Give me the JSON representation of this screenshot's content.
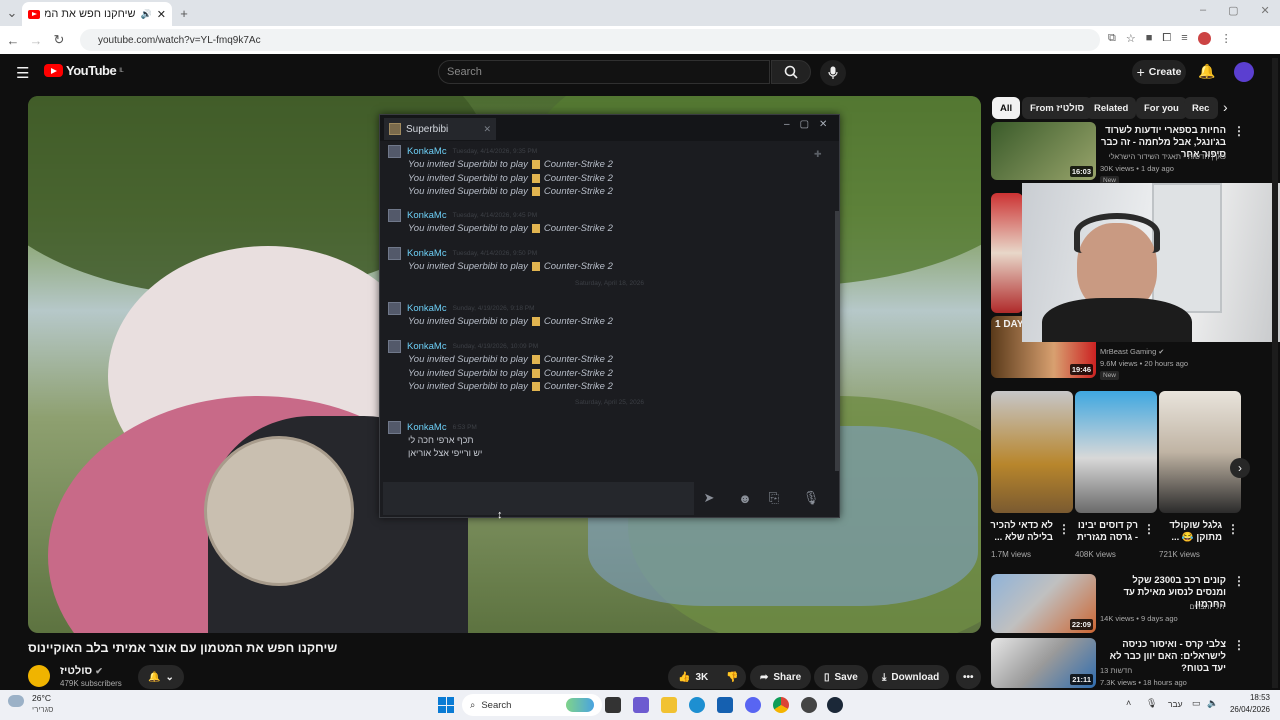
{
  "browser": {
    "tab_title": "שיחקנו חפש את המטמון עם אוצר אמיתי בלב האוקיינוס - YouTube",
    "url": "youtube.com/watch?v=YL-fmq9k7Ac"
  },
  "youtube": {
    "logo_text": "YouTube",
    "logo_region": "IL",
    "search_placeholder": "Search",
    "create_label": "Create"
  },
  "steam": {
    "friend_name": "Superbibi",
    "messages": [
      {
        "name": "KonkaMc",
        "time": "Tuesday, 4/14/2026, 9:35 PM",
        "lines": [
          "You invited Superbibi to play",
          "You invited Superbibi to play",
          "You invited Superbibi to play"
        ]
      },
      {
        "name": "KonkaMc",
        "time": "Tuesday, 4/14/2026, 9:45 PM",
        "lines": [
          "You invited Superbibi to play"
        ]
      },
      {
        "name": "KonkaMc",
        "time": "Tuesday, 4/14/2026, 9:50 PM",
        "lines": [
          "You invited Superbibi to play"
        ]
      },
      {
        "name": "KonkaMc",
        "time": "Sunday, 4/19/2026, 9:18 PM",
        "lines": [
          "You invited Superbibi to play"
        ]
      },
      {
        "name": "KonkaMc",
        "time": "Sunday, 4/19/2026, 10:09 PM",
        "lines": [
          "You invited Superbibi to play",
          "You invited Superbibi to play",
          "You invited Superbibi to play"
        ]
      },
      {
        "name": "KonkaMc",
        "time": "6:53 PM",
        "plain": [
          "תכף ארפי חכה לי",
          "יש ורייפי אצל אוריאן"
        ]
      }
    ],
    "game": "Counter-Strike 2",
    "date_separators": [
      "Saturday, April 18, 2026",
      "Saturday, April 25, 2026"
    ]
  },
  "video": {
    "title": "שיחקנו חפש את המטמון עם אוצר אמיתי בלב האוקיינוס",
    "channel": "סולטיז",
    "subscribers": "479K subscribers",
    "likes": "3K",
    "share": "Share",
    "save": "Save",
    "download": "Download"
  },
  "sidebar": {
    "chips": [
      "All",
      "From סולטיז",
      "Related",
      "For you",
      "Rec"
    ],
    "items": [
      {
        "title": "החיות בספארי יודעות לשרוד בג'ונגל, אבל מלחמה - זה כבר סיפור אחר",
        "channel": "כאן | חדשות - תאגיד השידור הישראלי",
        "meta": "30K views • 1 day ago",
        "duration": "16:03",
        "new": "New"
      },
      {
        "title": "",
        "channel": "MrBeast Gaming",
        "meta": "9.6M views • 20 hours ago",
        "duration": "19:46",
        "new": "New",
        "label": "1 DAY"
      },
      {
        "title": "קונים רכב ב2300 שקל ומנסים לנסוע מאילת עד החרמון",
        "channel": "יהלי והברים",
        "meta": "14K views • 9 days ago",
        "duration": "22:09"
      },
      {
        "title": "צלבי קרס - ואיסור כניסה לישראלים: האם יוון כבר לא יעד בטוח?",
        "channel": "13 חדשות",
        "meta": "7.3K views • 18 hours ago",
        "duration": "21:11"
      }
    ],
    "shorts": [
      {
        "title": "לא כדאי להכיר בלילה שלא ...",
        "views": "1.7M views"
      },
      {
        "title": "רק דוסים יבינו - גרסה מגזרית",
        "views": "408K views"
      },
      {
        "title": "גלגל שוקולד מתוקן 😂 ...",
        "views": "721K views"
      }
    ]
  },
  "taskbar": {
    "weather_temp": "26°C",
    "weather_desc": "סגרירי",
    "search_label": "Search",
    "lang": "עבר",
    "time": "18:53",
    "date": "26/04/2026"
  }
}
